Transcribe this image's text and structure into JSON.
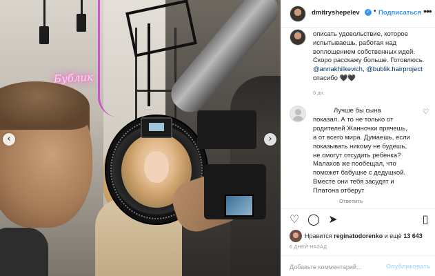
{
  "photo": {
    "neon_sign": "Бублик",
    "prev_label": "‹",
    "next_label": "›"
  },
  "header": {
    "username": "dmitryshepelev",
    "verified_mark": "✓",
    "separator": "•",
    "follow_label": "Подписаться",
    "more_label": "•••"
  },
  "post": {
    "caption_lines": [
      "описать удовольствие, которое",
      "испытываешь, работая над",
      "воплощением собственных идей.",
      "Скоро расскажу больше. Готовлюсь.",
      "спасибо 🖤🖤"
    ],
    "mention1": "@annakhilkevich",
    "mention_sep": ", ",
    "mention2": "@bublik.hairproject",
    "time": "6 дн."
  },
  "comment": {
    "lines": [
      "Лучше бы сына",
      "показал. А то не только от",
      "родителей Жанночки прячешь,",
      "а от всего мира. Думаешь, если",
      "показывать никому не будешь,",
      "не смогут отсудить ребенка?",
      "Малахов же пообещал, что",
      "поможет бабушке с дедушкой.",
      "Вместе они тебя засудят и",
      "Платона отберут"
    ],
    "reply_label": "Ответить",
    "like_icon": "♡"
  },
  "actions": {
    "like_icon": "♡",
    "comment_icon": "◯",
    "share_icon": "➤",
    "save_icon": "▯"
  },
  "likes": {
    "prefix": "Нравится ",
    "user": "reginatodorenko",
    "middle": " и ещё ",
    "count": "13 643"
  },
  "date": "6 ДНЕЙ НАЗАД",
  "add_comment": {
    "placeholder": "Добавьте комментарий...",
    "publish_label": "Опубликовать"
  }
}
